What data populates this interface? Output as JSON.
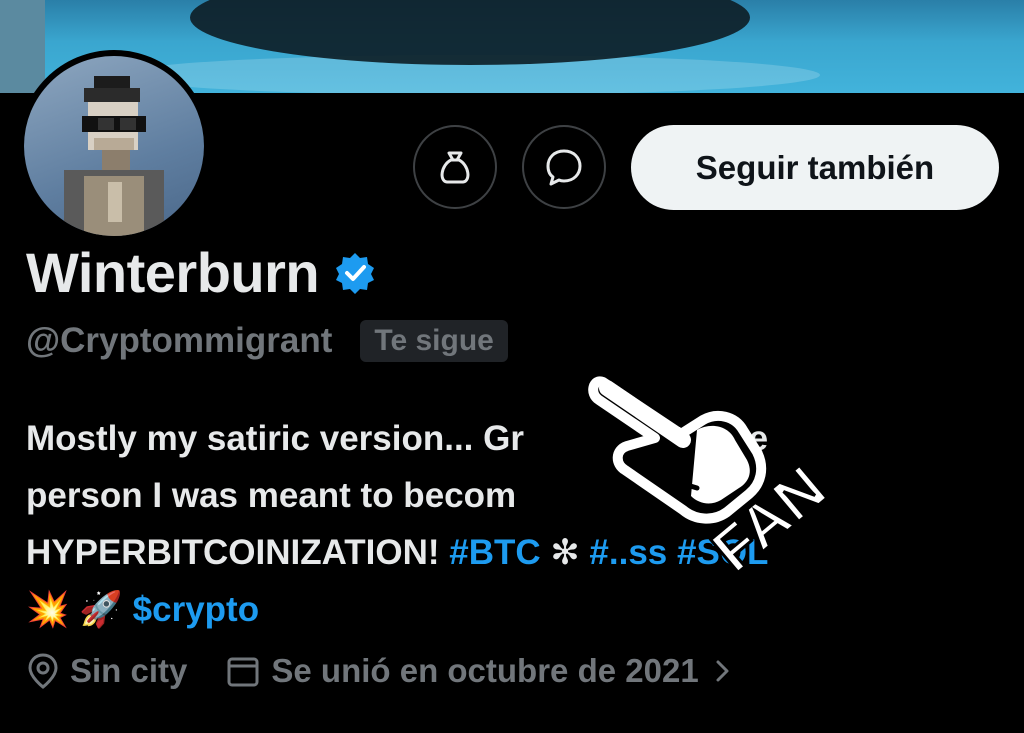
{
  "profile": {
    "name": "Winterburn",
    "handle": "@Cryptommigrant",
    "follows_you": "Te sigue",
    "verified": true
  },
  "actions": {
    "tip_icon": "money-bag-icon",
    "message_icon": "message-bubble-icon",
    "follow_label": "Seguir también"
  },
  "bio": {
    "line1": "Mostly my satiric version... Gr",
    "line1_end": " into the",
    "line2": "person I was meant to becom",
    "line3_text": "HYPERBITCOINIZATION! ",
    "tag_btc": "#BTC",
    "tag_mid": "#..ss",
    "tag_sol": "#SOL",
    "emoji_boom": "💥",
    "emoji_rocket": "🚀",
    "cashtag": "$crypto"
  },
  "meta": {
    "location": "Sin city",
    "joined": "Se unió en octubre de 2021"
  },
  "sticker": {
    "text": "FAN"
  },
  "colors": {
    "link": "#1d9bf0",
    "muted": "#71767b",
    "follow_bg": "#eff3f4"
  }
}
